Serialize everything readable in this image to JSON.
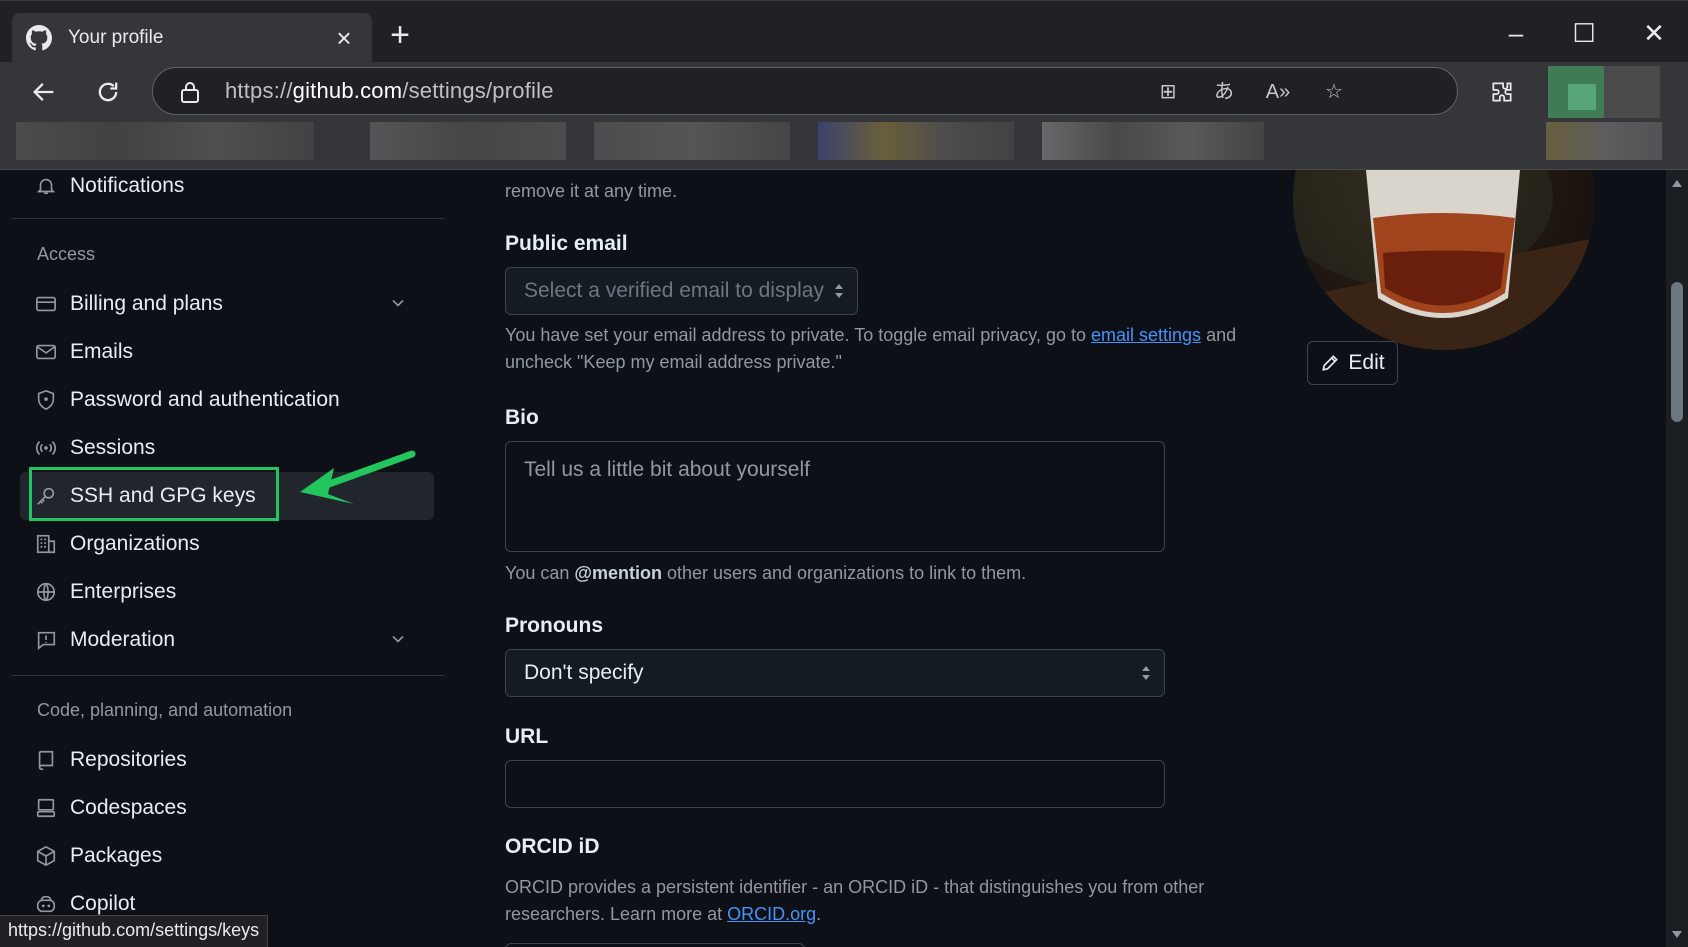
{
  "browser": {
    "tab_title": "Your profile",
    "url_prefix": "https://",
    "url_host": "github.com",
    "url_path": "/settings/profile",
    "status_url": "https://github.com/settings/keys"
  },
  "sidebar": {
    "notifications": "Notifications",
    "access_heading": "Access",
    "billing": "Billing and plans",
    "emails": "Emails",
    "password": "Password and authentication",
    "sessions": "Sessions",
    "ssh": "SSH and GPG keys",
    "organizations": "Organizations",
    "enterprises": "Enterprises",
    "moderation": "Moderation",
    "code_heading": "Code, planning, and automation",
    "repositories": "Repositories",
    "codespaces": "Codespaces",
    "packages": "Packages",
    "copilot": "Copilot"
  },
  "form": {
    "top_note": "remove it at any time.",
    "public_email_label": "Public email",
    "public_email_placeholder": "Select a verified email to display",
    "email_note_a": "You have set your email address to private. To toggle email privacy, go to ",
    "email_settings_link": "email settings",
    "email_note_b": " and",
    "email_note_c": "uncheck \"Keep my email address private.\"",
    "bio_label": "Bio",
    "bio_placeholder": "Tell us a little bit about yourself",
    "bio_note_a": "You can ",
    "bio_note_mention": "@mention",
    "bio_note_b": " other users and organizations to link to them.",
    "pronouns_label": "Pronouns",
    "pronouns_value": "Don't specify",
    "url_label": "URL",
    "url_value": "",
    "orcid_label": "ORCID iD",
    "orcid_note_a": "ORCID provides a persistent identifier - an ORCID iD - that distinguishes you from other",
    "orcid_note_b": "researchers. Learn more at ",
    "orcid_link": "ORCID.org",
    "orcid_note_c": "."
  },
  "avatar": {
    "edit_label": "Edit"
  },
  "colors": {
    "accent_link": "#4493f8",
    "highlight": "#22c55e"
  }
}
